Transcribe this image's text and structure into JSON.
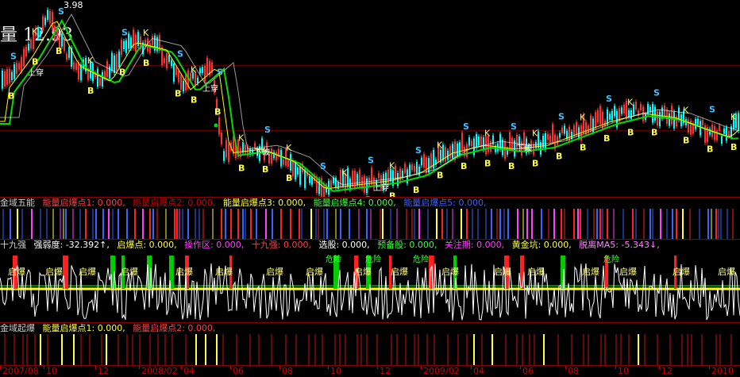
{
  "colors": {
    "background": "#000000",
    "separator": "#8b0000",
    "candle_up": "#ff3030",
    "candle_down": "#00ffff",
    "ma_green": "#00dd00",
    "ma_yellow": "#ffff00",
    "ma_magenta": "#ff00ff",
    "white_line": "#ffffff",
    "signal_blue": "#3366ff",
    "signal_red": "#ff2020"
  },
  "top": {
    "price_readout": "3.98",
    "big_value": "量 12.93"
  },
  "price_panel": {
    "markers_B": "B",
    "markers_S": "S",
    "markers_K": "K",
    "marker_up": "上穿",
    "marker_down": "下破"
  },
  "panel2": {
    "name": "金域五能",
    "items": [
      {
        "text": "能量启爆点1: 0.000,",
        "color": "#ff4040"
      },
      {
        "text": "能量启爆点2: 0.000,",
        "color": "#cc0000"
      },
      {
        "text": "能量启爆点3: 0.000,",
        "color": "#ffff40"
      },
      {
        "text": "能量启爆点4: 0.000,",
        "color": "#40ff40"
      },
      {
        "text": "能量启爆点5: 0.000,",
        "color": "#4060ff"
      }
    ]
  },
  "panel3": {
    "name": "十九强",
    "items": [
      {
        "text": "强弱度: -32.392↑,",
        "color": "#ffffff"
      },
      {
        "text": "启爆点: 0.000,",
        "color": "#ffff40"
      },
      {
        "text": "操作区: 0.000,",
        "color": "#ff40ff"
      },
      {
        "text": "十九强: 0.000,",
        "color": "#ff4040"
      },
      {
        "text": "选股: 0.000,",
        "color": "#ffffff"
      },
      {
        "text": "预备股: 0.000,",
        "color": "#40ff40"
      },
      {
        "text": "关注期: 0.000,",
        "color": "#ff40ff"
      },
      {
        "text": "黄金坑: 0.000,",
        "color": "#ffff40"
      },
      {
        "text": "脱离MA5: -5.343↓,",
        "color": "#ff80ff"
      }
    ],
    "label_qibao": "启爆",
    "label_danger": "危险"
  },
  "panel4": {
    "name": "金域起爆",
    "items": [
      {
        "text": "能量启爆点1: 0.000,",
        "color": "#ffff40"
      },
      {
        "text": "能量启爆点2: 0.000,",
        "color": "#ff4040"
      }
    ]
  },
  "axis": {
    "ticks": [
      "2007/08",
      "10",
      "12",
      "2008/02",
      "04",
      "06",
      "08",
      "10",
      "12",
      "2009/02",
      "04",
      "06",
      "08",
      "10",
      "12",
      "2010"
    ]
  }
}
